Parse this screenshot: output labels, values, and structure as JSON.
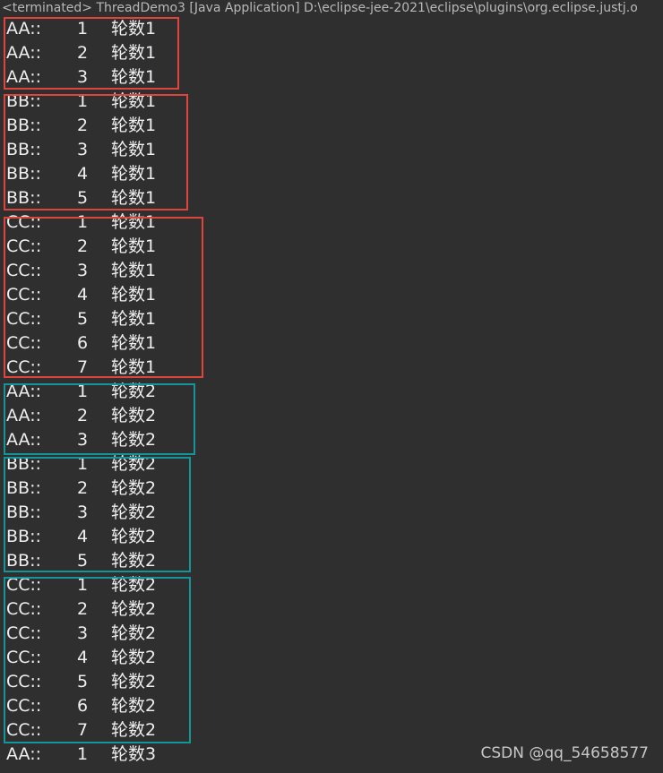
{
  "header": {
    "title": "<terminated> ThreadDemo3 [Java Application] D:\\eclipse-jee-2021\\eclipse\\plugins\\org.eclipse.justj.o"
  },
  "theme": {
    "red_box": "#e0453b",
    "teal_box": "#14959a"
  },
  "console": {
    "lines": [
      {
        "name": "AA::",
        "num": "1",
        "round": "轮数1"
      },
      {
        "name": "AA::",
        "num": "2",
        "round": "轮数1"
      },
      {
        "name": "AA::",
        "num": "3",
        "round": "轮数1"
      },
      {
        "name": "BB::",
        "num": "1",
        "round": "轮数1"
      },
      {
        "name": "BB::",
        "num": "2",
        "round": "轮数1"
      },
      {
        "name": "BB::",
        "num": "3",
        "round": "轮数1"
      },
      {
        "name": "BB::",
        "num": "4",
        "round": "轮数1"
      },
      {
        "name": "BB::",
        "num": "5",
        "round": "轮数1"
      },
      {
        "name": "CC::",
        "num": "1",
        "round": "轮数1"
      },
      {
        "name": "CC::",
        "num": "2",
        "round": "轮数1"
      },
      {
        "name": "CC::",
        "num": "3",
        "round": "轮数1"
      },
      {
        "name": "CC::",
        "num": "4",
        "round": "轮数1"
      },
      {
        "name": "CC::",
        "num": "5",
        "round": "轮数1"
      },
      {
        "name": "CC::",
        "num": "6",
        "round": "轮数1"
      },
      {
        "name": "CC::",
        "num": "7",
        "round": "轮数1"
      },
      {
        "name": "AA::",
        "num": "1",
        "round": "轮数2"
      },
      {
        "name": "AA::",
        "num": "2",
        "round": "轮数2"
      },
      {
        "name": "AA::",
        "num": "3",
        "round": "轮数2"
      },
      {
        "name": "BB::",
        "num": "1",
        "round": "轮数2"
      },
      {
        "name": "BB::",
        "num": "2",
        "round": "轮数2"
      },
      {
        "name": "BB::",
        "num": "3",
        "round": "轮数2"
      },
      {
        "name": "BB::",
        "num": "4",
        "round": "轮数2"
      },
      {
        "name": "BB::",
        "num": "5",
        "round": "轮数2"
      },
      {
        "name": "CC::",
        "num": "1",
        "round": "轮数2"
      },
      {
        "name": "CC::",
        "num": "2",
        "round": "轮数2"
      },
      {
        "name": "CC::",
        "num": "3",
        "round": "轮数2"
      },
      {
        "name": "CC::",
        "num": "4",
        "round": "轮数2"
      },
      {
        "name": "CC::",
        "num": "5",
        "round": "轮数2"
      },
      {
        "name": "CC::",
        "num": "6",
        "round": "轮数2"
      },
      {
        "name": "CC::",
        "num": "7",
        "round": "轮数2"
      },
      {
        "name": "AA::",
        "num": "1",
        "round": "轮数3"
      }
    ]
  },
  "watermark": "CSDN @qq_54658577"
}
